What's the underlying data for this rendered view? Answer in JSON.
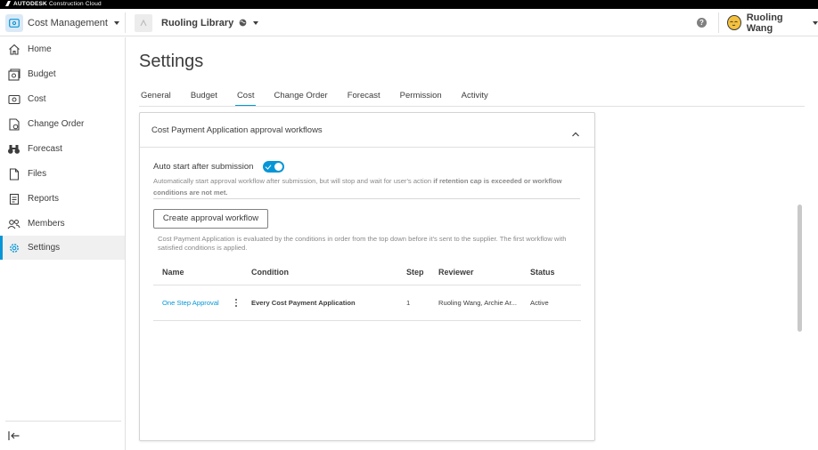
{
  "topbar": {
    "brand": "AUTODESK",
    "product": "Construction Cloud"
  },
  "header": {
    "module": "Cost Management",
    "project": "Ruoling Library",
    "help": "?",
    "user": "Ruoling Wang"
  },
  "sidebar": {
    "items": [
      {
        "label": "Home",
        "icon": "home-icon"
      },
      {
        "label": "Budget",
        "icon": "budget-icon"
      },
      {
        "label": "Cost",
        "icon": "cost-icon"
      },
      {
        "label": "Change Order",
        "icon": "change-order-icon"
      },
      {
        "label": "Forecast",
        "icon": "binoculars-icon"
      },
      {
        "label": "Files",
        "icon": "file-icon"
      },
      {
        "label": "Reports",
        "icon": "report-icon"
      },
      {
        "label": "Members",
        "icon": "members-icon"
      },
      {
        "label": "Settings",
        "icon": "gear-icon",
        "active": true
      }
    ]
  },
  "main": {
    "title": "Settings",
    "tabs": [
      {
        "label": "General"
      },
      {
        "label": "Budget"
      },
      {
        "label": "Cost",
        "active": true
      },
      {
        "label": "Change Order"
      },
      {
        "label": "Forecast"
      },
      {
        "label": "Permission"
      },
      {
        "label": "Activity"
      }
    ]
  },
  "card": {
    "title": "Cost Payment Application approval workflows",
    "toggle_label": "Auto start after submission",
    "toggle_on": true,
    "toggle_desc_plain": "Automatically start approval workflow after submission, but will stop and wait for user's action",
    "toggle_desc_bold": "if retention cap is exceeded or workflow conditions are not met.",
    "create_button": "Create approval workflow",
    "order_note": "Cost Payment Application is evaluated by the conditions in order from the top down before it's sent to the supplier. The first workflow with satisfied conditions is applied.",
    "columns": {
      "name": "Name",
      "condition": "Condition",
      "step": "Step",
      "reviewer": "Reviewer",
      "status": "Status"
    },
    "rows": [
      {
        "name": "One Step Approval",
        "condition": "Every Cost Payment Application",
        "step": "1",
        "reviewer": "Ruoling Wang, Archie Ar...",
        "status": "Active"
      }
    ]
  },
  "colors": {
    "accent": "#0696d7",
    "text": "#3c3c3c",
    "muted": "#8a8a8a",
    "border": "#e0e0e0"
  }
}
